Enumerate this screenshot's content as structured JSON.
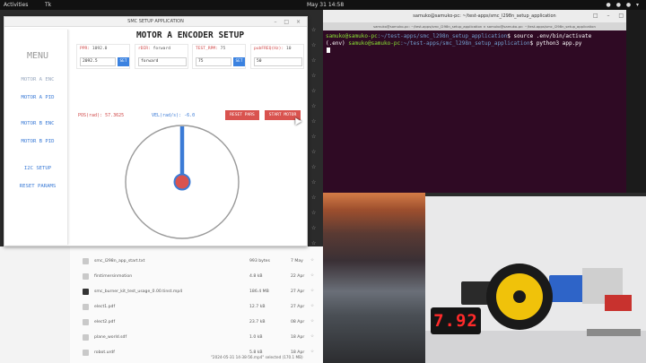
{
  "topbar": {
    "activities": "Activities",
    "app_indicator": "Tk",
    "clock": "May 31  14:58",
    "tray": "● ● ● ▾"
  },
  "window": {
    "title": "SMC SETUP APPLICATION",
    "buttons": "– □ ×"
  },
  "sidebar": {
    "title": "MENU",
    "items": [
      {
        "label": "MOTOR A ENC",
        "state": "dim"
      },
      {
        "label": "MOTOR A PID",
        "state": "active"
      },
      {
        "label": "MOTOR B ENC",
        "state": "active"
      },
      {
        "label": "MOTOR B PID",
        "state": "active"
      },
      {
        "label": "I2C SETUP",
        "state": "active"
      },
      {
        "label": "RESET PARAMS",
        "state": "active"
      }
    ]
  },
  "main": {
    "title": "MOTOR A ENCODER SETUP",
    "params": [
      {
        "key": "PPR:",
        "value": " 1092.0",
        "input": "2092.5",
        "set": "SET"
      },
      {
        "key": "rDIR:",
        "value": " forward",
        "input": "forward",
        "set": ""
      },
      {
        "key": "TEST_RPM:",
        "value": " 75",
        "input": "75",
        "set": "SET"
      },
      {
        "key": "pubFREQ(Hz):",
        "value": " 10",
        "input": "50",
        "set": ""
      }
    ],
    "pos_readout": "POS(rad): 57.3625",
    "vel_readout": "VEL(rad/s): -6.0",
    "reset_button": "RESET PARS",
    "start_button": "START MOTOR",
    "dial_angle_deg": 0
  },
  "terminal": {
    "title": "samuko@samuko-pc: ~/test-apps/smc_l298n_setup_application",
    "tabs": "samuko@samuko-pc: ~/test-apps/smc_l298n_setup_application  ×   samuko@samuko-pc: ~/test-apps/smc_l298n_setup_application",
    "buttons": "□ – □ ×",
    "lines": [
      {
        "prompt": "samuko@samuko-pc",
        "path": ":~/test-apps/smc_l298n_setup_application",
        "cmd": "$ source .env/bin/activate"
      },
      {
        "prefix": "(.env) ",
        "prompt": "samuko@samuko-pc",
        "path": ":~/test-apps/smc_l298n_setup_application",
        "cmd": "$ python3 app.py"
      }
    ]
  },
  "files": {
    "rows": [
      {
        "name": "smc_l298n_app_start.txt",
        "size": "993 bytes",
        "date": "7 May",
        "type": "doc"
      },
      {
        "name": "firstimersinmotion",
        "size": "4.8 kB",
        "date": "22 Apr",
        "type": "doc"
      },
      {
        "name": "smc_burner_kit_test_usage_0.00.tinst.mp4",
        "size": "186.4 MB",
        "date": "27 Apr",
        "type": "vid"
      },
      {
        "name": "elect1.pdf",
        "size": "12.7 kB",
        "date": "27 Apr",
        "type": "doc"
      },
      {
        "name": "elect2.pdf",
        "size": "23.7 kB",
        "date": "08 Apr",
        "type": "doc"
      },
      {
        "name": "plane_world.sdf",
        "size": "1.0 kB",
        "date": "18 Apr",
        "type": "doc"
      },
      {
        "name": "robot.urdf",
        "size": "5.8 kB",
        "date": "18 Apr",
        "type": "doc"
      }
    ],
    "status": "\"2024-05-31 14-38-56.mp4\" selected (170.1 MB)"
  },
  "camera": {
    "display_value": "7.92"
  },
  "colors": {
    "accent": "#3b7bd6",
    "danger": "#d9534f",
    "terminal_bg": "#2f0a24"
  }
}
